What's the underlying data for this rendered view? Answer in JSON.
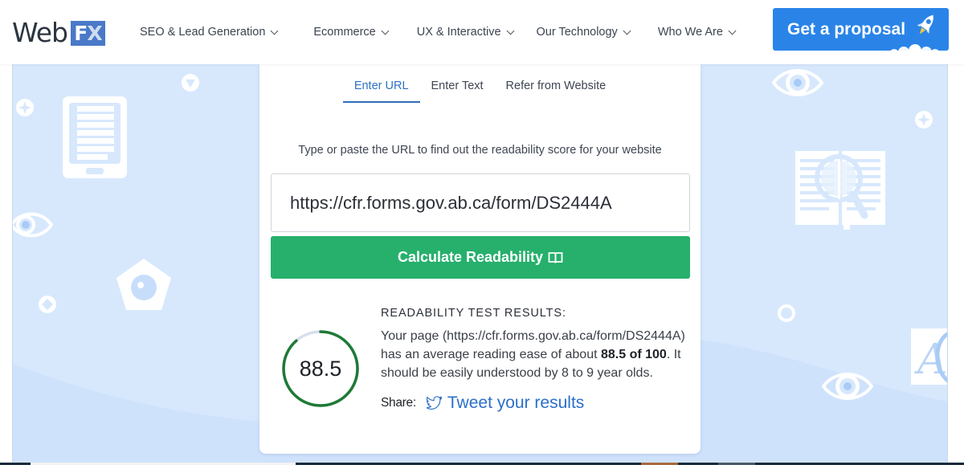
{
  "header": {
    "logo": {
      "web": "Web",
      "f": "F",
      "x": "X"
    },
    "nav": [
      {
        "label": "SEO & Lead Generation"
      },
      {
        "label": "Ecommerce"
      },
      {
        "label": "UX & Interactive"
      },
      {
        "label": "Our Technology"
      },
      {
        "label": "Who We Are"
      }
    ],
    "cta_label": "Get a proposal"
  },
  "tool": {
    "tabs": [
      {
        "label": "Enter URL",
        "active": true
      },
      {
        "label": "Enter Text",
        "active": false
      },
      {
        "label": "Refer from Website",
        "active": false
      }
    ],
    "instruction": "Type or paste the URL to find out the readability score for your website",
    "url_value": "https://cfr.forms.gov.ab.ca/form/DS2444A",
    "calculate_label": "Calculate Readability"
  },
  "results": {
    "title": "READABILITY TEST RESULTS:",
    "score": "88.5",
    "score_fraction": 0.885,
    "body_prefix": "Your page (https://cfr.forms.gov.ab.ca/form/DS2444A) has an average reading ease of about ",
    "body_bold": "88.5 of 100",
    "body_suffix": ". It should be easily understood by 8 to 9 year olds.",
    "share_label": "Share:",
    "tweet_label": "Tweet your results"
  },
  "colors": {
    "brand_blue": "#2a84e8",
    "button_green": "#26b06c",
    "ring_green": "#1e7a36",
    "ring_track": "#d8deef",
    "tab_active": "#2d72c4",
    "hero_bg": "#d7e8fd"
  }
}
